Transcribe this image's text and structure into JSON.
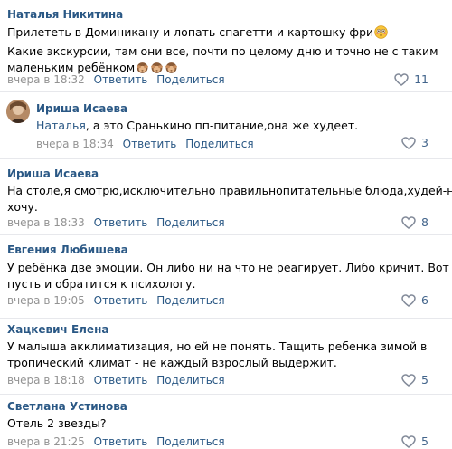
{
  "comments": [
    {
      "author": "Наталья Никитина",
      "lines": [
        "Прилететь в Доминикану и лопать спагетти и картошку фри",
        "Какие экскурсии, там они все, почти по целому дню и точно не с таким",
        "маленьким ребёнком"
      ],
      "emoji_shock": "flushed-face-emoji",
      "emoji_monkeys": "see-no-evil-monkey-emoji",
      "date": "вчера в 18:32",
      "reply": "Ответить",
      "share": "Поделиться",
      "likes": "11"
    },
    {
      "author": "Ириша Исаева",
      "mention": "Наталья",
      "text": ", а это Сранькино пп-питание,она же худеет.",
      "date": "вчера в 18:34",
      "reply": "Ответить",
      "share": "Поделиться",
      "likes": "3"
    },
    {
      "author": "Ириша Исаева",
      "lines": [
        "На столе,я смотрю,исключительно правильнопитательные блюда,худей-не",
        "хочу."
      ],
      "date": "вчера в 18:33",
      "reply": "Ответить",
      "share": "Поделиться",
      "likes": "8"
    },
    {
      "author": "Евгения Любишева",
      "lines": [
        "У ребёнка две эмоции. Он либо ни на что не реагирует. Либо кричит. Вот",
        "пусть и обратится к психологу."
      ],
      "date": "вчера в 19:05",
      "reply": "Ответить",
      "share": "Поделиться",
      "likes": "6"
    },
    {
      "author": "Хацкевич Елена",
      "lines": [
        "У малыша акклиматизация, но ей не понять. Тащить ребенка зимой в",
        "тропический климат - не каждый взрослый выдержит."
      ],
      "date": "вчера в 18:18",
      "reply": "Ответить",
      "share": "Поделиться",
      "likes": "5"
    },
    {
      "author": "Светлана Устинова",
      "lines": [
        "Отель 2 звезды?"
      ],
      "date": "вчера в 21:25",
      "reply": "Ответить",
      "share": "Поделиться",
      "likes": "5"
    }
  ],
  "colors": {
    "link": "#2a5885",
    "muted": "#939393",
    "like": "#42648b",
    "divider": "#e7e8ec"
  },
  "icons": {
    "like": "heart-icon"
  }
}
